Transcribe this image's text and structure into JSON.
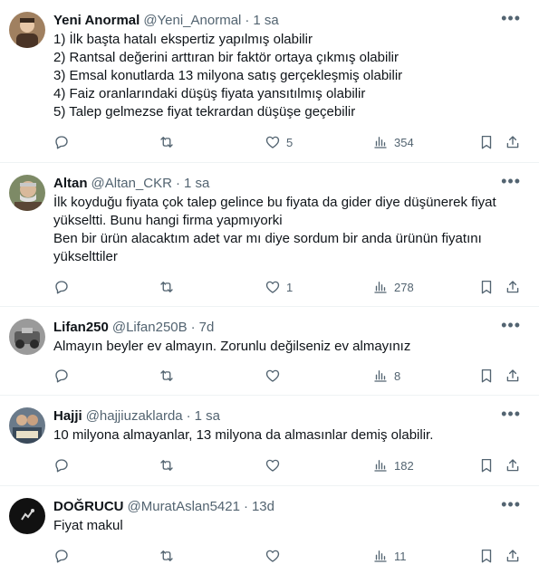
{
  "tweets": [
    {
      "name": "Yeni Anormal",
      "handle": "@Yeni_Anormal",
      "time": "1 sa",
      "lines": [
        "1) İlk başta hatalı ekspertiz yapılmış olabilir",
        "2) Rantsal değerini arttıran bir faktör ortaya çıkmış olabilir",
        "3) Emsal konutlarda 13 milyona satış gerçekleşmiş olabilir",
        "4) Faiz oranlarındaki düşüş fiyata yansıtılmış olabilir",
        "5) Talep gelmezse fiyat tekrardan düşüşe geçebilir"
      ],
      "likes": "5",
      "views": "354",
      "avatar_color": "#7a5a3a"
    },
    {
      "name": "Altan",
      "handle": "@Altan_CKR",
      "time": "1 sa",
      "lines": [
        "İlk koyduğu fiyata çok talep gelince bu fiyata da gider diye düşünerek fiyat",
        "yükseltti. Bunu hangi firma yapmıyorki",
        "Ben bir ürün alacaktım adet var mı diye sordum bir anda ürünün fiyatını",
        "yükselttiler"
      ],
      "likes": "1",
      "views": "278",
      "avatar_color": "#6b7a55"
    },
    {
      "name": "Lifan250",
      "handle": "@Lifan250B",
      "time": "7d",
      "lines": [
        "Almayın beyler ev almayın. Zorunlu değilseniz ev almayınız"
      ],
      "likes": "",
      "views": "8",
      "avatar_color": "#8a8a8a"
    },
    {
      "name": "Hajji",
      "handle": "@hajjiuzaklarda",
      "time": "1 sa",
      "lines": [
        "10 milyona almayanlar, 13 milyona da almasınlar demiş olabilir."
      ],
      "likes": "",
      "views": "182",
      "avatar_color": "#556070"
    },
    {
      "name": "DOĞRUCU",
      "handle": "@MuratAslan5421",
      "time": "13d",
      "lines": [
        "Fiyat makul"
      ],
      "likes": "",
      "views": "11",
      "avatar_color": "#151515"
    }
  ],
  "ui": {
    "dot": "·",
    "more": "•••"
  },
  "icons": [
    "reply-icon",
    "retweet-icon",
    "like-icon",
    "views-icon",
    "bookmark-icon",
    "share-icon",
    "more-icon"
  ],
  "colors": {
    "text": "#0f1419",
    "muted": "#536471",
    "divider": "#eff3f4"
  }
}
